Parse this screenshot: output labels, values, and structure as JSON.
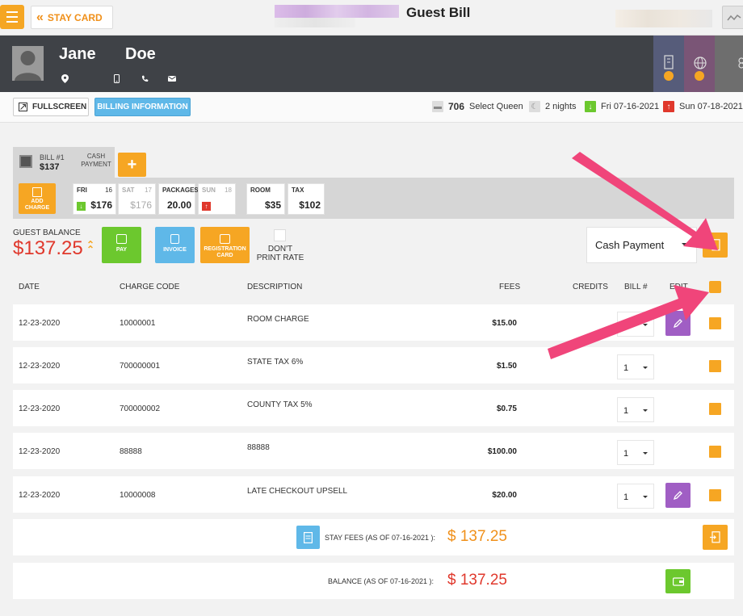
{
  "header": {
    "stay_card_label": "STAY CARD",
    "page_title": "Guest Bill"
  },
  "guest": {
    "first_name": "Jane",
    "last_name": "Doe"
  },
  "toolbar": {
    "fullscreen_label": "FULLSCREEN",
    "billing_info_label": "BILLING INFORMATION",
    "room_number": "706",
    "room_type": "Select Queen",
    "nights": "2 nights",
    "arrival": "Fri 07-16-2021",
    "departure": "Sun 07-18-2021"
  },
  "bill": {
    "tab_label": "BILL #1",
    "tab_amount": "$137",
    "payment_type": "CASH PAYMENT",
    "add_bill": "+"
  },
  "charges_band": {
    "add_charge_label": "ADD CHARGE",
    "days": [
      {
        "day": "FRI",
        "num": "16",
        "amount": "$176",
        "arrow": "down",
        "dim": false
      },
      {
        "day": "SAT",
        "num": "17",
        "amount": "$176",
        "arrow": "",
        "dim": true
      },
      {
        "day": "PACKAGES",
        "num": "",
        "amount": "20.00",
        "arrow": "",
        "dim": false
      },
      {
        "day": "SUN",
        "num": "18",
        "amount": "",
        "arrow": "up",
        "dim": true
      }
    ],
    "room_label": "ROOM",
    "room_amount": "$35",
    "tax_label": "TAX",
    "tax_amount": "$102"
  },
  "balance": {
    "label": "GUEST BALANCE",
    "amount": "$137.25",
    "pay_label": "PAY",
    "invoice_label": "INVOICE",
    "registration_label": "REGISTRATION CARD",
    "dont_print_label": "DON'T PRINT RATE",
    "payment_method": "Cash Payment"
  },
  "table": {
    "headers": {
      "date": "DATE",
      "charge_code": "CHARGE CODE",
      "description": "DESCRIPTION",
      "fees": "FEES",
      "credits": "CREDITS",
      "bill_no": "BILL #",
      "edit": "EDIT"
    },
    "rows": [
      {
        "date": "12-23-2020",
        "code": "10000001",
        "desc": "ROOM CHARGE",
        "fee": "$15.00",
        "bill": "1",
        "editable": true
      },
      {
        "date": "12-23-2020",
        "code": "700000001",
        "desc": "STATE TAX 6%",
        "fee": "$1.50",
        "bill": "1",
        "editable": false
      },
      {
        "date": "12-23-2020",
        "code": "700000002",
        "desc": "COUNTY TAX 5%",
        "fee": "$0.75",
        "bill": "1",
        "editable": false
      },
      {
        "date": "12-23-2020",
        "code": "88888",
        "desc": "88888",
        "fee": "$100.00",
        "bill": "1",
        "editable": false
      },
      {
        "date": "12-23-2020",
        "code": "10000008",
        "desc": "LATE CHECKOUT UPSELL",
        "fee": "$20.00",
        "bill": "1",
        "editable": true
      }
    ]
  },
  "summary": {
    "stay_fees_label": "STAY FEES (AS OF 07-16-2021 ):",
    "stay_fees_amount": "$ 137.25",
    "balance_label": "BALANCE (AS OF 07-16-2021 ):",
    "balance_amount": "$ 137.25"
  },
  "colors": {
    "accent": "#f6a623",
    "balance_red": "#e0382c",
    "pay_green": "#6cc82e",
    "invoice_blue": "#5fb8e8",
    "edit_purple": "#a05ec4",
    "annotation_arrow": "#f0457a"
  }
}
